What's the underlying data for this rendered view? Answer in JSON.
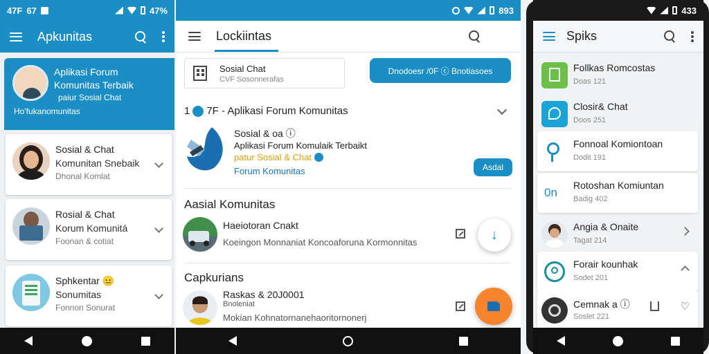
{
  "panel1": {
    "status": {
      "time": "47F",
      "extra": "67",
      "battery": "47%"
    },
    "appbar": {
      "title": "Apkunitas"
    },
    "hero": {
      "line1": "Aplikasi Forum",
      "line2": "Komunitas Terbaik",
      "line3": "paiur Sosial Chat",
      "line4": "Ho'fukanomunitas"
    },
    "cards": [
      {
        "t1": "Sosial & Chat",
        "t2": "Komunitan Snebaik",
        "t3": "Dhonal Komlat"
      },
      {
        "t1": "Rosial & Chat",
        "t2": "Korum Komunitá",
        "t3": "Foonan & cotiat"
      },
      {
        "t1": "Sphkentar 😐",
        "t2": "Sonumitas",
        "t3": "Fonnon Sonurat"
      }
    ]
  },
  "panel2": {
    "status": {
      "time": "893"
    },
    "appbar": {
      "title": "Lockiintas"
    },
    "tile": {
      "t1": "Sosial Chat",
      "t2": "CVF Sosonnerafas"
    },
    "action_button": "Dnodoesr /0F ⓒ Bnotiasoes",
    "heading": "7F - Aplikasi Forum Komunitas",
    "heading_prefix": "1",
    "post": {
      "t1": "Sosial & oa ⓘ",
      "t2": "Aplikasi Forum Komulaik Terbaikt",
      "t3": "patur Sosial & Chat",
      "t4": "Forum Komunitas",
      "button": "Asdal"
    },
    "section1": {
      "title": "Aasial Komunitas",
      "t1": "Haeiotoran Cnakt",
      "t2": "Koeingon Monnaniat Koncoaforuna Kormonnitas",
      "fab": "↓"
    },
    "section2": {
      "title": "Capkurians",
      "t1": "Raskas & 20J0001",
      "t1b": "Bnoleniat",
      "t2": "Mokian Kohnatornanehaoritornonerj"
    }
  },
  "panel3": {
    "status": {
      "time": "433"
    },
    "appbar": {
      "title": "Spiks"
    },
    "rows": [
      {
        "t1": "Follkas Romcostas",
        "t2": "Doas  121"
      },
      {
        "t1": "Closir& Chat",
        "t2": "Doos  251"
      },
      {
        "t1": "Fonnoal Komiontoan",
        "t2": "Dodit  191"
      },
      {
        "t1": "Rotoshan Komiuntan",
        "t2": "Badig  402"
      },
      {
        "t1": "Angia & Onaite",
        "t2": "Tagat  214"
      },
      {
        "t1": "Forair kounhak",
        "t2": "Sodet  201"
      },
      {
        "t1": "Cemnak a ⓘ",
        "t2": "Soslet  221"
      }
    ],
    "row3_label": "0n"
  },
  "colors": {
    "primary": "#1b8ec6",
    "accent": "#f5842c",
    "navbar": "#111111"
  }
}
